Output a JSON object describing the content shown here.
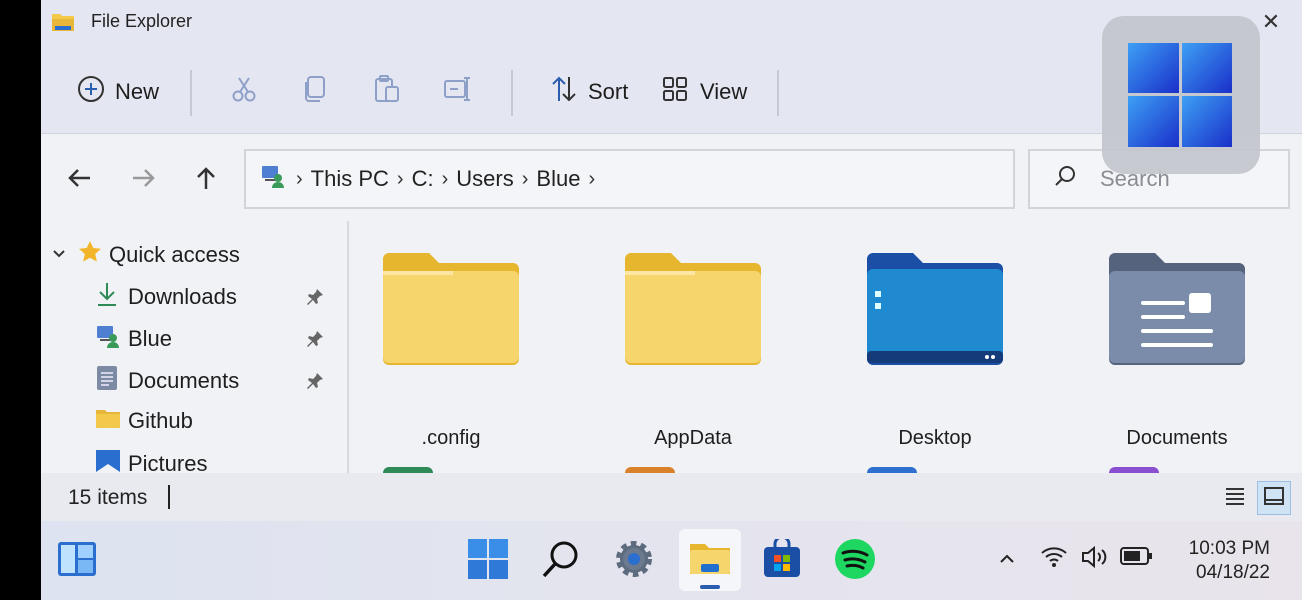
{
  "window": {
    "title": "File Explorer",
    "close_glyph": "✕"
  },
  "command_bar": {
    "new_label": "New",
    "sort_label": "Sort",
    "view_label": "View",
    "icons": [
      "add-circle-icon",
      "cut-icon",
      "copy-icon",
      "paste-icon",
      "rename-icon",
      "sort-icon",
      "view-grid-icon"
    ]
  },
  "address_bar": {
    "crumbs": [
      "This PC",
      "C:",
      "Users",
      "Blue"
    ],
    "separator": "›"
  },
  "search": {
    "placeholder": "Search"
  },
  "nav_pane": {
    "quick_access": "Quick access",
    "items": [
      {
        "label": "Downloads",
        "icon": "download-arrow-icon",
        "pinned": true
      },
      {
        "label": "Blue",
        "icon": "user-pc-icon",
        "pinned": true
      },
      {
        "label": "Documents",
        "icon": "documents-icon",
        "pinned": true
      },
      {
        "label": "Github",
        "icon": "folder-icon",
        "pinned": false
      },
      {
        "label": "Pictures",
        "icon": "pictures-icon",
        "pinned": false
      }
    ]
  },
  "content": {
    "items": [
      {
        "label": ".config",
        "icon": "yellow-folder-icon"
      },
      {
        "label": "AppData",
        "icon": "yellow-folder-icon"
      },
      {
        "label": "Desktop",
        "icon": "desktop-folder-icon"
      },
      {
        "label": "Documents",
        "icon": "documents-folder-icon"
      }
    ],
    "peek_colors": [
      "#2e8b57",
      "#d9822b",
      "#2f6fd0",
      "#8a4fd0"
    ]
  },
  "status_bar": {
    "item_count": "15 items"
  },
  "taskbar": {
    "time": "10:03 PM",
    "date": "04/18/22",
    "apps": [
      "widgets-icon",
      "start-icon",
      "search-icon",
      "settings-gear-icon",
      "file-explorer-icon",
      "store-icon",
      "spotify-icon"
    ],
    "tray": [
      "chevron-up-icon",
      "wifi-icon",
      "volume-icon",
      "battery-icon"
    ]
  },
  "colors": {
    "accent": "#2a5db0",
    "folder_yellow": "#f3c94b",
    "desktop_blue": "#1f78c8",
    "documents_gray": "#6f7f99"
  }
}
